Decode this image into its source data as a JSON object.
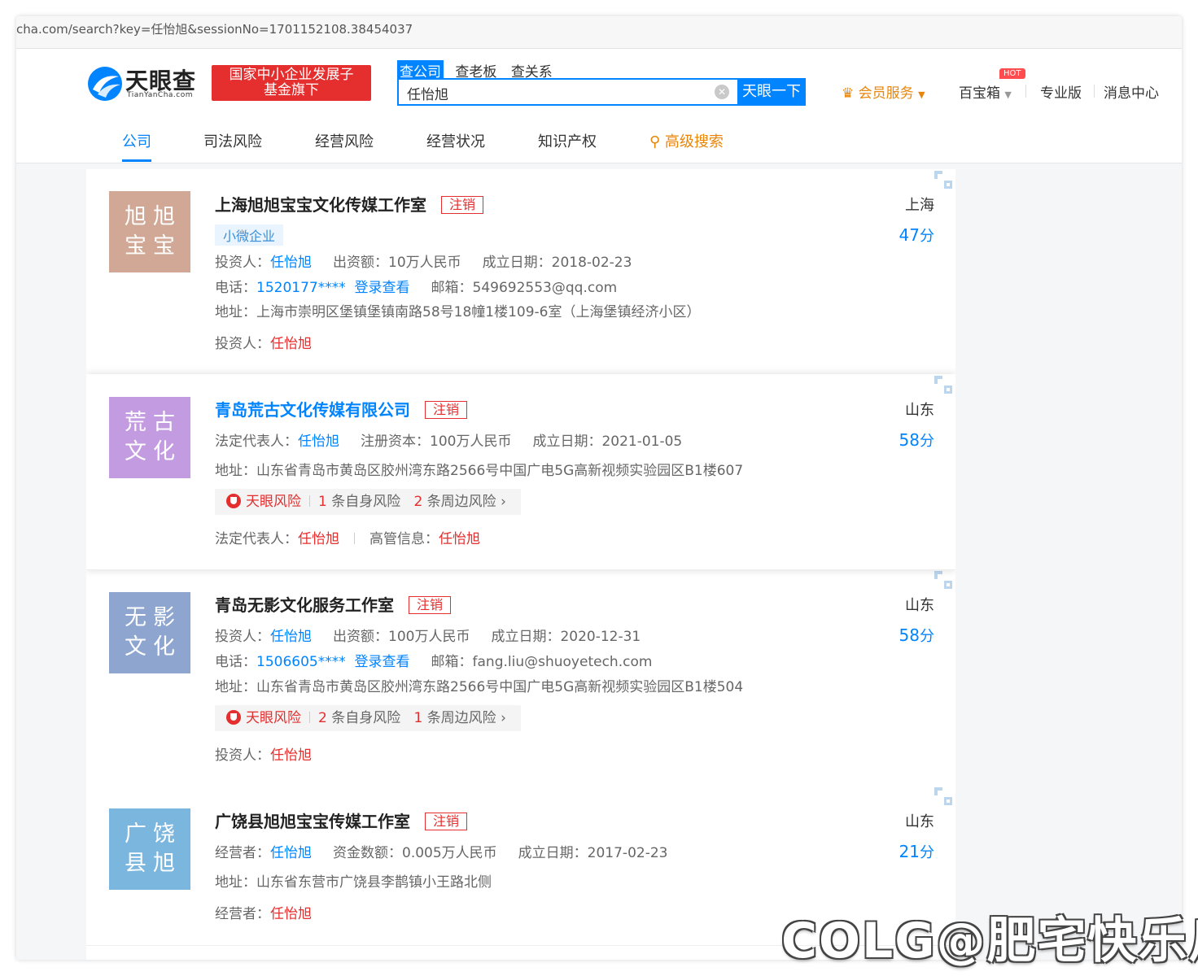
{
  "browser": {
    "url": "cha.com/search?key=任怡旭&sessionNo=1701152108.38454037"
  },
  "header": {
    "logo_text": "天眼查",
    "logo_sub": "TianYanCha.com",
    "fund_badge_line1": "国家中小企业发展子",
    "fund_badge_line2": "基金旗下",
    "search_tabs": [
      "查公司",
      "查老板",
      "查关系"
    ],
    "search_value": "任怡旭",
    "search_button": "天眼一下",
    "vip": "会员服务",
    "baobao": "百宝箱",
    "hot": "HOT",
    "pro": "专业版",
    "messages": "消息中心"
  },
  "tabs": [
    "公司",
    "司法风险",
    "经营风险",
    "经营状况",
    "知识产权",
    "高级搜索"
  ],
  "results": [
    {
      "avatar_line1": "旭旭",
      "avatar_line2": "宝宝",
      "avatar_color": "#d0a895",
      "name": "上海旭旭宝宝文化传媒工作室",
      "status": "注销",
      "tag": "小微企业",
      "region": "上海",
      "score": "47",
      "score_unit": "分",
      "row1": {
        "k1": "投资人：",
        "v1": "任怡旭",
        "k2": "出资额：",
        "v2": "10万人民币",
        "k3": "成立日期：",
        "v3": "2018-02-23"
      },
      "row2": {
        "k1": "电话：",
        "v1": "1520177****",
        "login": "登录查看",
        "k2": "邮箱：",
        "v2": "549692553@qq.com"
      },
      "row3": {
        "k1": "地址：",
        "v1": "上海市崇明区堡镇堡镇南路58号18幢1楼109-6室（上海堡镇经济小区）"
      },
      "row4": {
        "k1": "投资人：",
        "v1": "任怡旭"
      }
    },
    {
      "avatar_line1": "荒古",
      "avatar_line2": "文化",
      "avatar_color": "#c39be0",
      "name": "青岛荒古文化传媒有限公司",
      "status": "注销",
      "region": "山东",
      "score": "58",
      "score_unit": "分",
      "row1": {
        "k1": "法定代表人：",
        "v1": "任怡旭",
        "k2": "注册资本：",
        "v2": "100万人民币",
        "k3": "成立日期：",
        "v3": "2021-01-05"
      },
      "row2": {
        "k1": "地址：",
        "v1": "山东省青岛市黄岛区胶州湾东路2566号中国广电5G高新视频实验园区B1楼607"
      },
      "risk": {
        "label": "天眼风险",
        "n1": "1",
        "t1": "条自身风险",
        "n2": "2",
        "t2": "条周边风险",
        "arrow": "›"
      },
      "row4": {
        "k1": "法定代表人：",
        "v1": "任怡旭",
        "k2": "高管信息：",
        "v2": "任怡旭"
      }
    },
    {
      "avatar_line1": "无影",
      "avatar_line2": "文化",
      "avatar_color": "#8ea6cf",
      "name": "青岛无影文化服务工作室",
      "status": "注销",
      "region": "山东",
      "score": "58",
      "score_unit": "分",
      "row1": {
        "k1": "投资人：",
        "v1": "任怡旭",
        "k2": "出资额：",
        "v2": "100万人民币",
        "k3": "成立日期：",
        "v3": "2020-12-31"
      },
      "row2": {
        "k1": "电话：",
        "v1": "1506605****",
        "login": "登录查看",
        "k2": "邮箱：",
        "v2": "fang.liu@shuoyetech.com"
      },
      "row3": {
        "k1": "地址：",
        "v1": "山东省青岛市黄岛区胶州湾东路2566号中国广电5G高新视频实验园区B1楼504"
      },
      "risk": {
        "label": "天眼风险",
        "n1": "2",
        "t1": "条自身风险",
        "n2": "1",
        "t2": "条周边风险",
        "arrow": "›"
      },
      "row4": {
        "k1": "投资人：",
        "v1": "任怡旭"
      }
    },
    {
      "avatar_line1": "广饶",
      "avatar_line2": "县旭",
      "avatar_color": "#7bb6df",
      "name": "广饶县旭旭宝宝传媒工作室",
      "status": "注销",
      "region": "山东",
      "score": "21",
      "score_unit": "分",
      "row1": {
        "k1": "经营者：",
        "v1": "任怡旭",
        "k2": "资金数额：",
        "v2": "0.005万人民币",
        "k3": "成立日期：",
        "v3": "2017-02-23"
      },
      "row2": {
        "k1": "地址：",
        "v1": "山东省东营市广饶县李鹊镇小王路北侧"
      },
      "row4": {
        "k1": "经营者：",
        "v1": "任怡旭"
      }
    }
  ],
  "watermark": "COLG@肥宅快乐瓜",
  "colors": {
    "accent": "#0084ff",
    "danger": "#e52e2e",
    "vip": "#e8850b"
  }
}
